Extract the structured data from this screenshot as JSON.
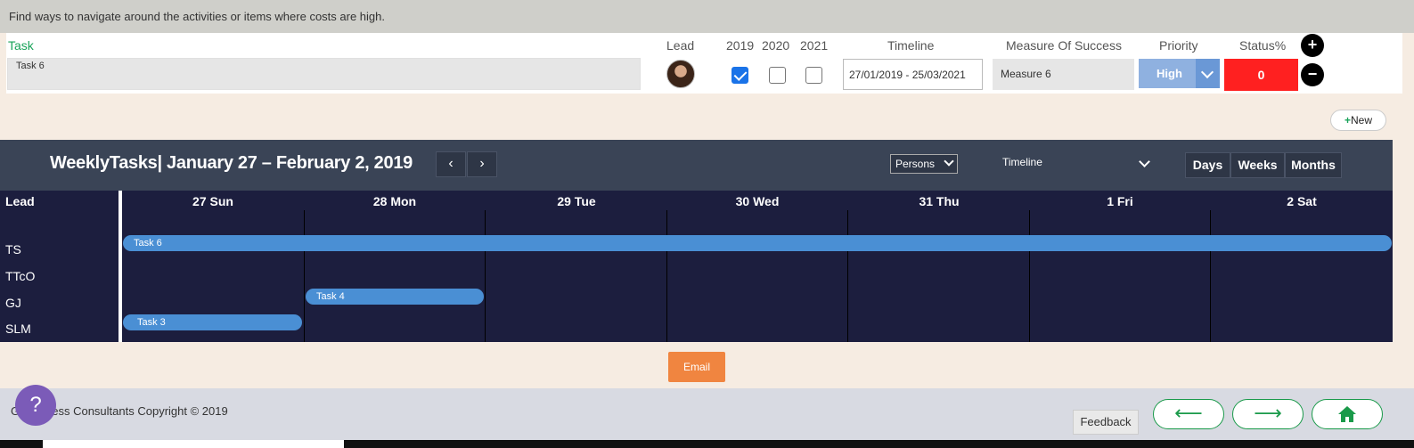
{
  "description": "Find ways to navigate around the activities or items where costs are high.",
  "task_row": {
    "headers": {
      "task": "Task",
      "lead": "Lead",
      "y2019": "2019",
      "y2020": "2020",
      "y2021": "2021",
      "timeline": "Timeline",
      "measure": "Measure Of Success",
      "priority": "Priority",
      "status": "Status%"
    },
    "task_value": "Task 6",
    "years_checked": {
      "y2019": true,
      "y2020": false,
      "y2021": false
    },
    "timeline_value": "27/01/2019 - 25/03/2021",
    "measure_value": "Measure 6",
    "priority_value": "High",
    "status_value": "0",
    "add_symbol": "+",
    "remove_symbol": "−"
  },
  "new_button": "New",
  "calendar": {
    "title": "WeeklyTasks| January 27 – February 2, 2019",
    "prev": "‹",
    "next": "›",
    "persons_select": "Persons",
    "timeline_select": "Timeline",
    "views": [
      "Days",
      "Weeks",
      "Months"
    ],
    "lead_header": "Lead",
    "days": [
      "27 Sun",
      "28 Mon",
      "29 Tue",
      "30 Wed",
      "31 Thu",
      "1 Fri",
      "2 Sat"
    ],
    "leads": [
      "TS",
      "TTcO",
      "GJ",
      "SLM"
    ],
    "tasks": [
      {
        "label": "Task 6",
        "lead": "TS"
      },
      {
        "label": "Task 4",
        "lead": "GJ"
      },
      {
        "label": "Task 3",
        "lead": "SLM"
      }
    ]
  },
  "email_button": "Email",
  "footer": {
    "copyright": "G       Business Consultants Copyright © 2019",
    "help": "?",
    "feedback": "Feedback",
    "back_arrow": "⟵",
    "forward_arrow": "⟶",
    "home_icon": "home-icon"
  },
  "colors": {
    "accent_green": "#1aa35a",
    "status_red": "#ff2020",
    "priority_blue": "#8fb1e0",
    "email_orange": "#f08540",
    "calendar_bg": "#1c1e3e",
    "task_bar": "#4a8fd4"
  }
}
